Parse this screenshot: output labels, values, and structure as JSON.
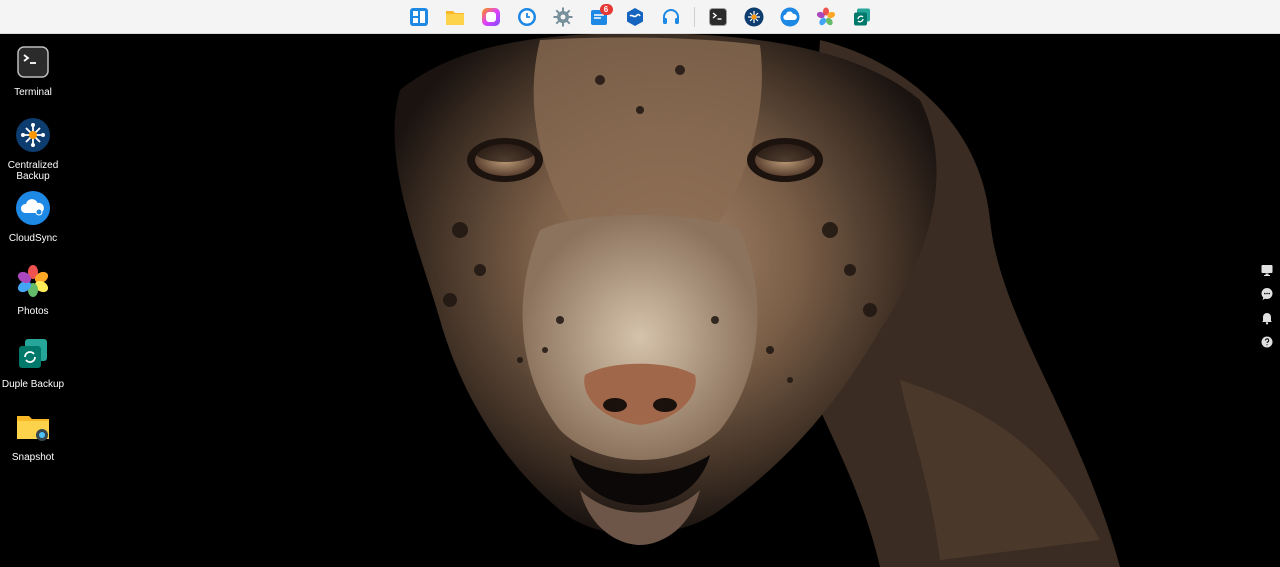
{
  "taskbar": {
    "items": [
      {
        "name": "main-menu",
        "icon": "grid-menu-icon"
      },
      {
        "name": "file-station",
        "icon": "folder-icon"
      },
      {
        "name": "app-center",
        "icon": "app-square-icon"
      },
      {
        "name": "clock-app",
        "icon": "clock-icon"
      },
      {
        "name": "settings",
        "icon": "gear-icon"
      },
      {
        "name": "message-center",
        "icon": "message-box-icon",
        "badge": "6"
      },
      {
        "name": "storage-manager",
        "icon": "box-icon"
      },
      {
        "name": "support-center",
        "icon": "headset-icon"
      },
      {
        "name": "terminal",
        "icon": "terminal-icon"
      },
      {
        "name": "centralized-backup",
        "icon": "backup-hub-icon"
      },
      {
        "name": "cloudsync",
        "icon": "cloud-icon"
      },
      {
        "name": "photos",
        "icon": "photos-flower-icon"
      },
      {
        "name": "duple-backup",
        "icon": "duple-backup-icon"
      }
    ]
  },
  "desktop": {
    "icons": [
      {
        "label": "Terminal",
        "icon": "terminal-icon"
      },
      {
        "label": "Centralized Backup",
        "icon": "backup-hub-icon"
      },
      {
        "label": "CloudSync",
        "icon": "cloud-icon"
      },
      {
        "label": "Photos",
        "icon": "photos-flower-icon"
      },
      {
        "label": "Duple Backup",
        "icon": "duple-backup-icon"
      },
      {
        "label": "Snapshot",
        "icon": "snapshot-folder-icon"
      }
    ]
  },
  "tray": {
    "items": [
      {
        "icon": "monitor-icon"
      },
      {
        "icon": "chat-bubble-icon"
      },
      {
        "icon": "bell-icon"
      },
      {
        "icon": "help-icon"
      }
    ]
  },
  "colors": {
    "taskbar_bg": "#f4f4f4",
    "desktop_bg": "#000000",
    "accent_blue": "#1e88e5",
    "badge_red": "#e53935",
    "folder_yellow": "#f9b825"
  }
}
